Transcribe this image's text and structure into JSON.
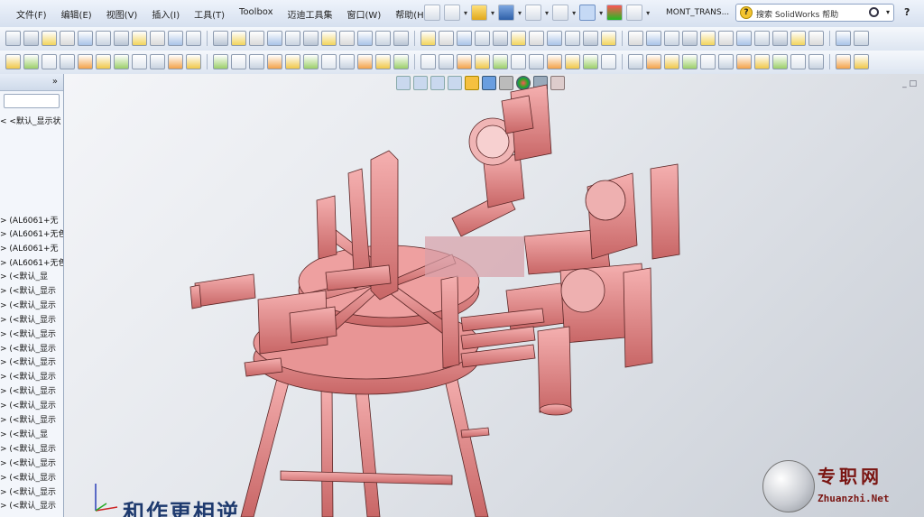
{
  "menubar": {
    "items": [
      "文件(F)",
      "编辑(E)",
      "视图(V)",
      "插入(I)",
      "工具(T)",
      "Toolbox",
      "迈迪工具集",
      "窗口(W)",
      "帮助(H)"
    ],
    "document_title": "MONT_TRANS...",
    "search_placeholder": "搜索 SolidWorks 帮助",
    "help_label": "?"
  },
  "sidebar": {
    "collapse_label": "»",
    "items": [
      "< <默认_显示状",
      "> (AL6061+无",
      "> (AL6061+无色",
      "> (AL6061+无",
      "> (AL6061+无色",
      "> (<默认_显",
      "> (<默认_显示",
      "> (<默认_显示",
      "> (<默认_显示",
      "> (<默认_显示",
      "> (<默认_显示",
      "> (<默认_显示",
      "> (<默认_显示",
      "> (<默认_显示",
      "> (<默认_显示",
      "> (<默认_显示",
      "> (<默认_显",
      "> (<默认_显示",
      "> (<默认_显示",
      "> (<默认_显示",
      "> (<默认_显示",
      "> (<默认_显示"
    ]
  },
  "viewport": {
    "overlay_text": "和作更相逆",
    "watermark_cn": "专职网",
    "watermark_url": "Zhuanzhi.Net"
  },
  "colors": {
    "model": "#e58a8a",
    "model_dark": "#b85d5d",
    "model_light": "#f5b3b3",
    "accent": "#6d8fc4"
  }
}
